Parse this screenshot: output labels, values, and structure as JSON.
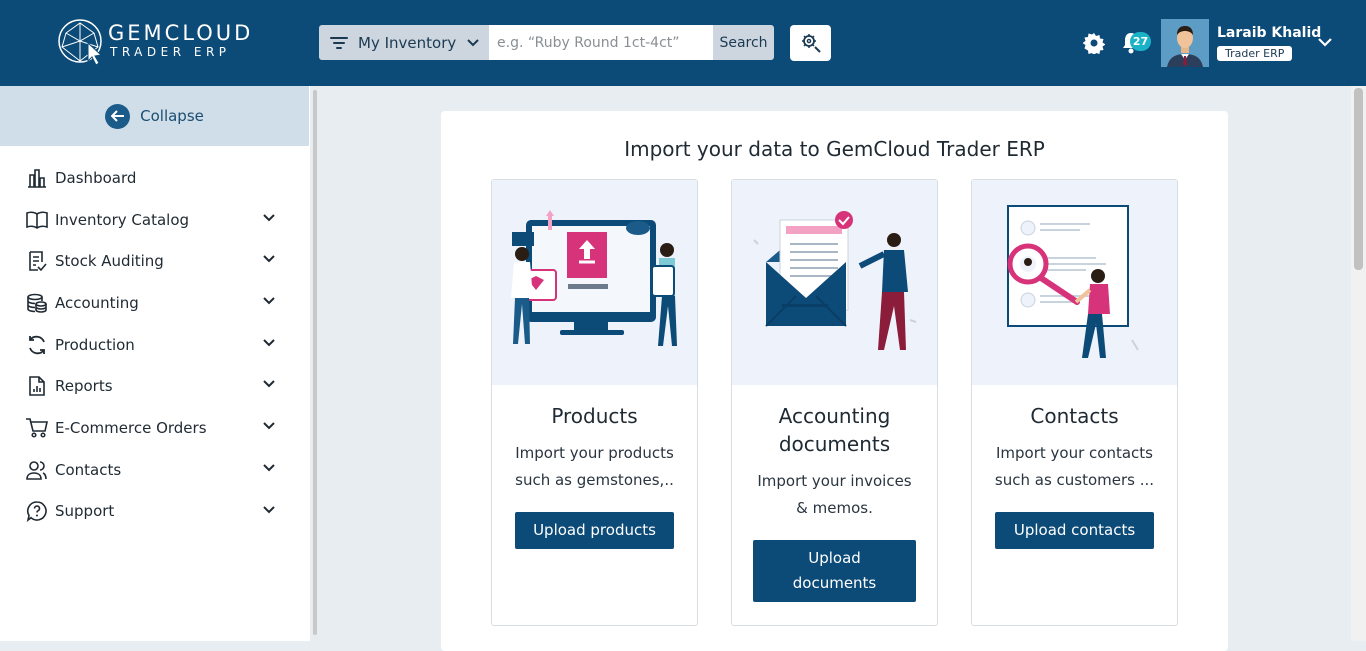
{
  "header": {
    "logo_title": "GEMCLOUD",
    "logo_subtitle": "TRADER ERP",
    "search_scope": "My Inventory",
    "search_placeholder": "e.g. “Ruby Round 1ct-4ct”",
    "search_button": "Search",
    "notification_count": "27",
    "user_name": "Laraib Khalid",
    "user_role": "Trader ERP"
  },
  "sidebar": {
    "collapse_label": "Collapse",
    "items": [
      {
        "label": "Dashboard",
        "icon": "dashboard-icon"
      },
      {
        "label": "Inventory Catalog",
        "icon": "book-icon"
      },
      {
        "label": "Stock Auditing",
        "icon": "audit-icon"
      },
      {
        "label": "Accounting",
        "icon": "coins-icon"
      },
      {
        "label": "Production",
        "icon": "sync-icon"
      },
      {
        "label": "Reports",
        "icon": "report-icon"
      },
      {
        "label": "E-Commerce Orders",
        "icon": "cart-icon"
      },
      {
        "label": "Contacts",
        "icon": "contacts-icon"
      },
      {
        "label": "Support",
        "icon": "support-icon"
      }
    ]
  },
  "main": {
    "title": "Import your data to GemCloud Trader ERP",
    "cards": [
      {
        "title": "Products",
        "desc1": "Import your products",
        "desc2": "such as gemstones,..",
        "button": "Upload products"
      },
      {
        "title1": "Accounting",
        "title2": "documents",
        "desc1": "Import your invoices",
        "desc2": "& memos.",
        "button1": "Upload",
        "button2": "documents"
      },
      {
        "title": "Contacts",
        "desc1": "Import your contacts",
        "desc2": "such as customers ...",
        "button": "Upload contacts"
      }
    ]
  },
  "colors": {
    "brand": "#0c4a78",
    "accent": "#d6337a",
    "badge": "#1bb2c8"
  }
}
